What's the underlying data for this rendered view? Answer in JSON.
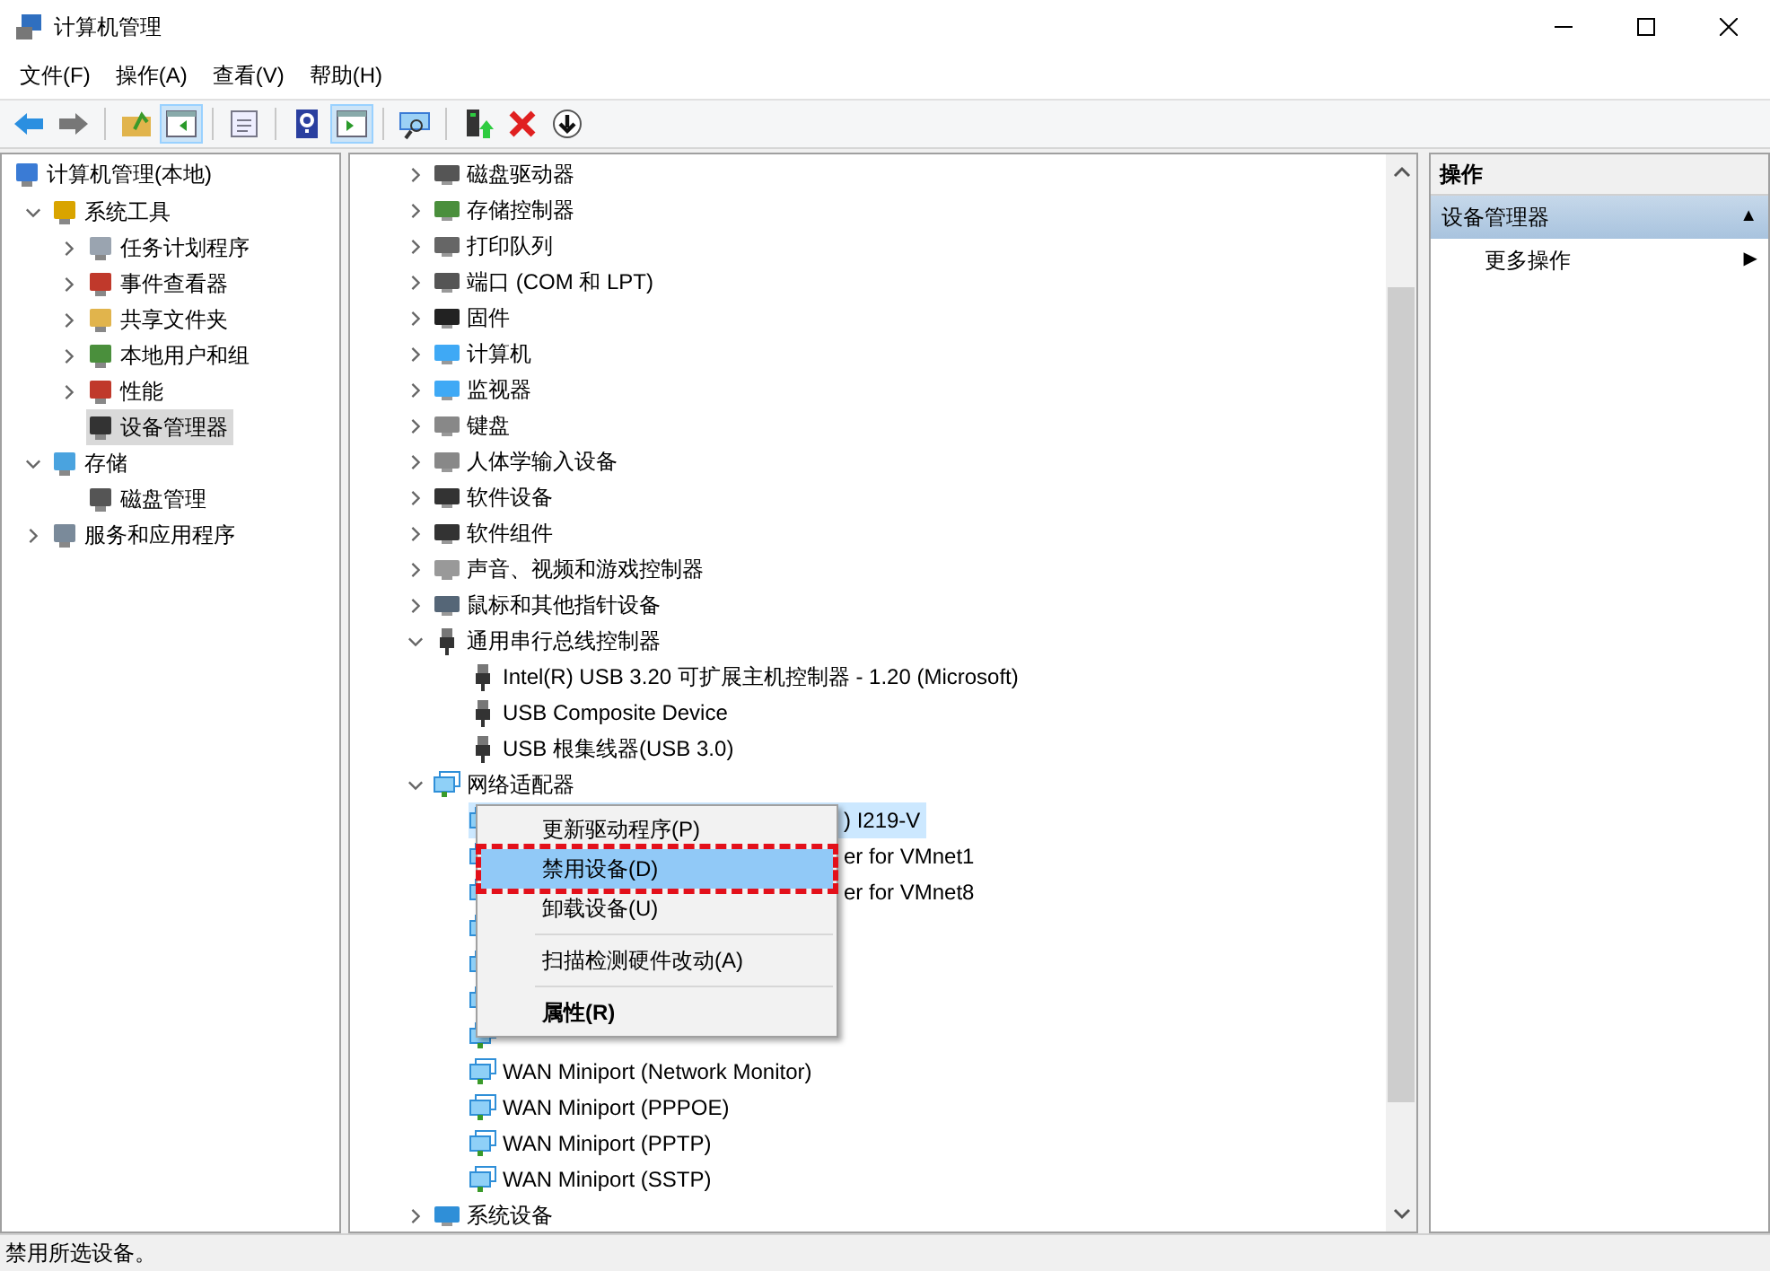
{
  "window": {
    "title": "计算机管理"
  },
  "menu_bar": [
    "文件(F)",
    "操作(A)",
    "查看(V)",
    "帮助(H)"
  ],
  "toolbar": [
    {
      "kind": "back",
      "pressed": false
    },
    {
      "kind": "forward",
      "pressed": false
    },
    {
      "kind": "sep"
    },
    {
      "kind": "folder-up",
      "pressed": false
    },
    {
      "kind": "pane-left",
      "pressed": true
    },
    {
      "kind": "sep"
    },
    {
      "kind": "sheet",
      "pressed": false
    },
    {
      "kind": "sep"
    },
    {
      "kind": "help",
      "pressed": false
    },
    {
      "kind": "pane-right",
      "pressed": true
    },
    {
      "kind": "sep"
    },
    {
      "kind": "monitor",
      "pressed": false
    },
    {
      "kind": "sep"
    },
    {
      "kind": "device-up",
      "pressed": false
    },
    {
      "kind": "delete",
      "pressed": false
    },
    {
      "kind": "down",
      "pressed": false
    }
  ],
  "nav_tree": [
    {
      "label": "计算机管理(本地)",
      "kind": "computer",
      "selected": false,
      "children": [
        {
          "label": "系统工具",
          "kind": "tools",
          "expanded": true,
          "selected": false,
          "children": [
            {
              "label": "任务计划程序",
              "kind": "clock",
              "expanded": false,
              "selected": false
            },
            {
              "label": "事件查看器",
              "kind": "log",
              "expanded": false,
              "selected": false
            },
            {
              "label": "共享文件夹",
              "kind": "folder",
              "expanded": false,
              "selected": false
            },
            {
              "label": "本地用户和组",
              "kind": "users",
              "expanded": false,
              "selected": false
            },
            {
              "label": "性能",
              "kind": "gauge",
              "expanded": false,
              "selected": false
            },
            {
              "label": "设备管理器",
              "kind": "device",
              "selected": true
            }
          ]
        },
        {
          "label": "存储",
          "kind": "storage",
          "expanded": true,
          "selected": false,
          "children": [
            {
              "label": "磁盘管理",
              "kind": "disk",
              "selected": false
            }
          ]
        },
        {
          "label": "服务和应用程序",
          "kind": "services",
          "expanded": false,
          "selected": false
        }
      ]
    }
  ],
  "device_tree": [
    {
      "label": "磁盘驱动器",
      "kind": "disk",
      "expanded": false,
      "selected": false
    },
    {
      "label": "存储控制器",
      "kind": "controller",
      "expanded": false,
      "selected": false
    },
    {
      "label": "打印队列",
      "kind": "printer",
      "expanded": false,
      "selected": false
    },
    {
      "label": "端口 (COM 和 LPT)",
      "kind": "port",
      "expanded": false,
      "selected": false
    },
    {
      "label": "固件",
      "kind": "chip",
      "expanded": false,
      "selected": false
    },
    {
      "label": "计算机",
      "kind": "monitor",
      "expanded": false,
      "selected": false
    },
    {
      "label": "监视器",
      "kind": "monitor",
      "expanded": false,
      "selected": false
    },
    {
      "label": "键盘",
      "kind": "keyboard",
      "expanded": false,
      "selected": false
    },
    {
      "label": "人体学输入设备",
      "kind": "keyboard",
      "expanded": false,
      "selected": false
    },
    {
      "label": "软件设备",
      "kind": "device",
      "expanded": false,
      "selected": false
    },
    {
      "label": "软件组件",
      "kind": "device",
      "expanded": false,
      "selected": false
    },
    {
      "label": "声音、视频和游戏控制器",
      "kind": "speaker",
      "expanded": false,
      "selected": false
    },
    {
      "label": "鼠标和其他指针设备",
      "kind": "mouse",
      "expanded": false,
      "selected": false
    },
    {
      "label": "通用串行总线控制器",
      "kind": "usb",
      "expanded": true,
      "selected": false,
      "children": [
        {
          "label": "Intel(R) USB 3.20 可扩展主机控制器 - 1.20 (Microsoft)",
          "kind": "usb",
          "selected": false
        },
        {
          "label": "USB Composite Device",
          "kind": "usb",
          "selected": false
        },
        {
          "label": "USB 根集线器(USB 3.0)",
          "kind": "usb",
          "selected": false
        }
      ]
    },
    {
      "label": "网络适配器",
      "kind": "network",
      "expanded": true,
      "selected": false,
      "children": [
        {
          "label": ") I219-V",
          "kind": "network",
          "covered": true,
          "selected": true
        },
        {
          "label": "er for VMnet1",
          "kind": "network",
          "covered": true,
          "selected": false
        },
        {
          "label": "er for VMnet8",
          "kind": "network",
          "covered": true,
          "selected": false
        },
        {
          "kind": "network"
        },
        {
          "kind": "network"
        },
        {
          "kind": "network"
        },
        {
          "kind": "network"
        },
        {
          "label": "WAN Miniport (Network Monitor)",
          "kind": "network",
          "selected": false
        },
        {
          "label": "WAN Miniport (PPPOE)",
          "kind": "network",
          "selected": false
        },
        {
          "label": "WAN Miniport (PPTP)",
          "kind": "network",
          "selected": false
        },
        {
          "label": "WAN Miniport (SSTP)",
          "kind": "network",
          "selected": false
        }
      ]
    },
    {
      "label": "系统设备",
      "kind": "system",
      "expanded": false,
      "selected": false
    }
  ],
  "context_menu": [
    {
      "kind": "item",
      "label": "更新驱动程序(P)",
      "selected": false,
      "bold": false
    },
    {
      "kind": "item",
      "label": "禁用设备(D)",
      "selected": true,
      "bold": false
    },
    {
      "kind": "item",
      "label": "卸载设备(U)",
      "selected": false,
      "bold": false
    },
    {
      "kind": "separator"
    },
    {
      "kind": "item",
      "label": "扫描检测硬件改动(A)",
      "selected": false,
      "bold": false
    },
    {
      "kind": "separator"
    },
    {
      "kind": "item",
      "label": "属性(R)",
      "selected": false,
      "bold": true
    }
  ],
  "actions_pane": {
    "title": "操作",
    "section": {
      "label": "设备管理器",
      "arrow": "▲",
      "expanded": true
    },
    "items": [
      {
        "label": "更多操作",
        "arrow": "▶"
      }
    ]
  },
  "status_bar": "禁用所选设备。"
}
